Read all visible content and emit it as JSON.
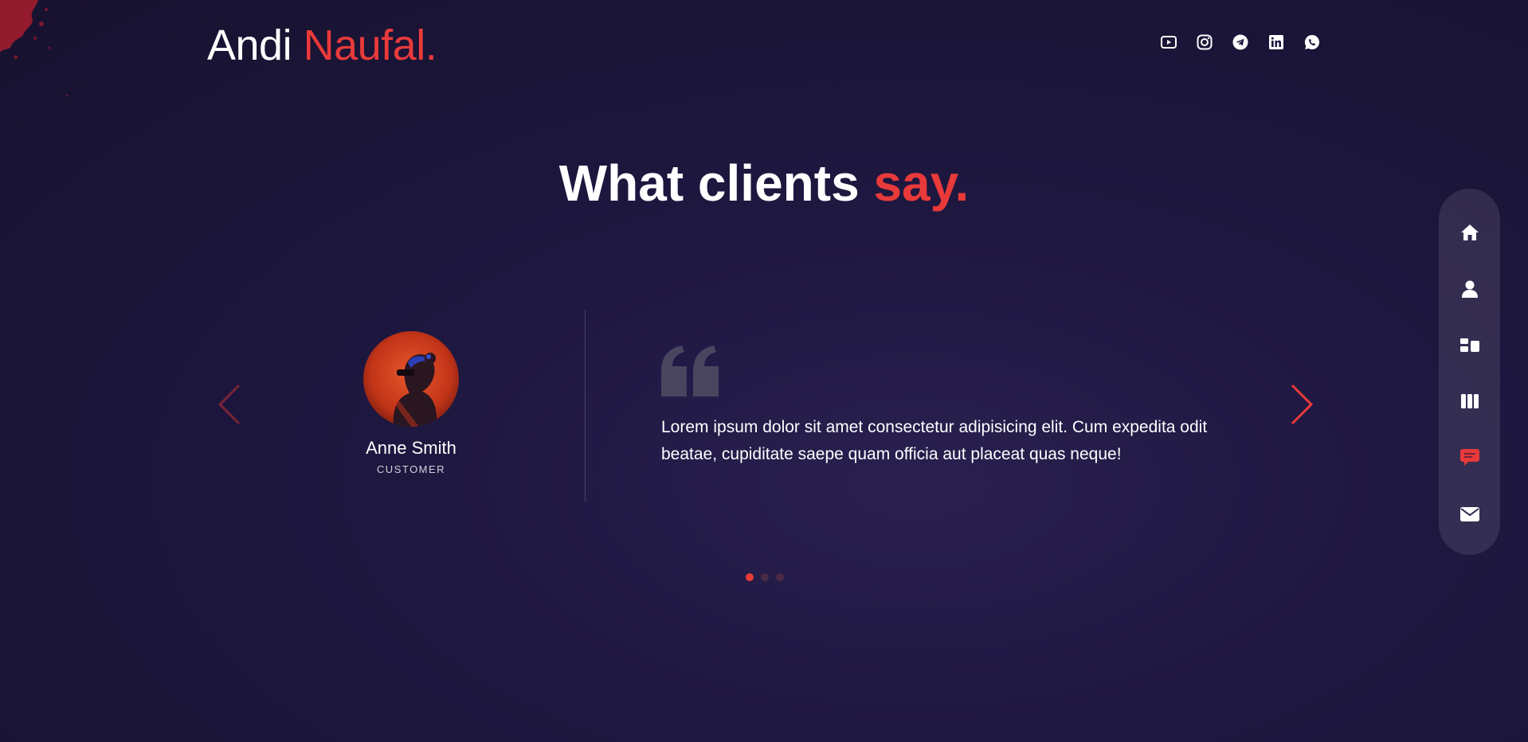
{
  "brand": {
    "first": "Andi",
    "last": "Naufal."
  },
  "colors": {
    "accent": "#e83a3a",
    "background": "#1e1740",
    "text": "#ffffff",
    "nav_pill": "rgba(255,255,255,0.1)"
  },
  "socials": [
    {
      "icon": "youtube-icon"
    },
    {
      "icon": "instagram-icon"
    },
    {
      "icon": "telegram-icon"
    },
    {
      "icon": "linkedin-icon"
    },
    {
      "icon": "whatsapp-icon"
    }
  ],
  "section": {
    "title_main": "What clients",
    "title_accent": "say."
  },
  "testimonial": {
    "name": "Anne Smith",
    "role": "CUSTOMER",
    "quote": "Lorem ipsum dolor sit amet consectetur adipisicing elit. Cum expedita odit beatae, cupiditate saepe quam officia aut placeat quas neque!"
  },
  "slider": {
    "total_slides": 3,
    "active_slide": 1
  },
  "sidenav": [
    {
      "icon": "home-icon",
      "active": false
    },
    {
      "icon": "user-icon",
      "active": false
    },
    {
      "icon": "services-icon",
      "active": false
    },
    {
      "icon": "portfolio-icon",
      "active": false
    },
    {
      "icon": "testimonials-icon",
      "active": true
    },
    {
      "icon": "mail-icon",
      "active": false
    }
  ]
}
